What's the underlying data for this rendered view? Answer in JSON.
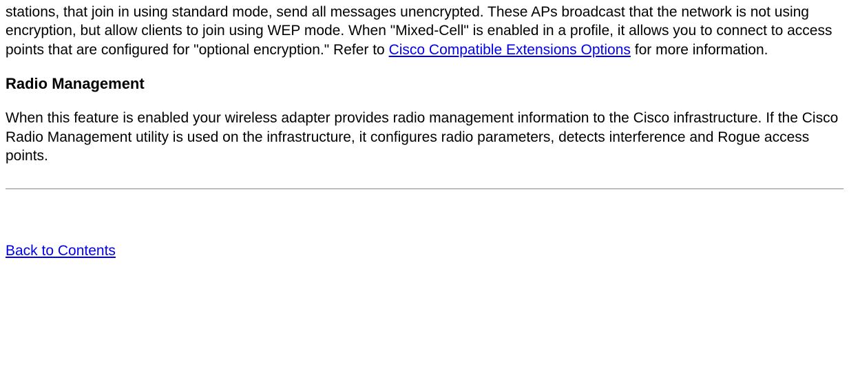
{
  "intro": {
    "part1": "stations, that join in using standard mode, send all messages unencrypted. These APs broadcast that the network is not using encryption, but allow clients to join using WEP mode. When \"Mixed-Cell\" is enabled in a profile, it allows you to connect to access points that are configured for \"optional encryption.\"  Refer to ",
    "link": "Cisco Compatible Extensions Options",
    "part2": " for more information."
  },
  "heading": "Radio Management",
  "body": "When this feature is enabled your wireless adapter provides radio management information to the Cisco infrastructure. If the Cisco Radio Management utility is used on the infrastructure, it configures radio parameters, detects interference and Rogue access points.",
  "back_link": "Back to Contents"
}
